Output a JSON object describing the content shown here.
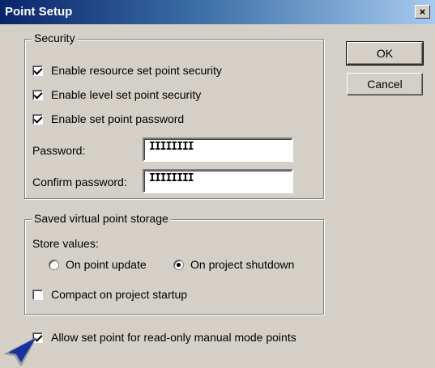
{
  "window": {
    "title": "Point Setup",
    "close_label": "×"
  },
  "buttons": {
    "ok": "OK",
    "cancel": "Cancel"
  },
  "security": {
    "legend": "Security",
    "checkboxes": [
      {
        "label": "Enable resource set point security",
        "checked": true
      },
      {
        "label": "Enable level set point security",
        "checked": true
      },
      {
        "label": "Enable set point password",
        "checked": true
      }
    ],
    "password_label": "Password:",
    "password_value": "IIIIIIII",
    "confirm_label": "Confirm password:",
    "confirm_value": "IIIIIIII"
  },
  "storage": {
    "legend": "Saved virtual point storage",
    "store_values_label": "Store values:",
    "radios": [
      {
        "label": "On point update",
        "selected": false
      },
      {
        "label": "On project shutdown",
        "selected": true
      }
    ],
    "compact": {
      "label": "Compact on project startup",
      "checked": false
    }
  },
  "allow_readonly": {
    "label": "Allow set point for read-only manual mode points",
    "checked": true
  },
  "icons": {
    "close": "close-icon",
    "pointer": "arrow-pointer-icon"
  }
}
